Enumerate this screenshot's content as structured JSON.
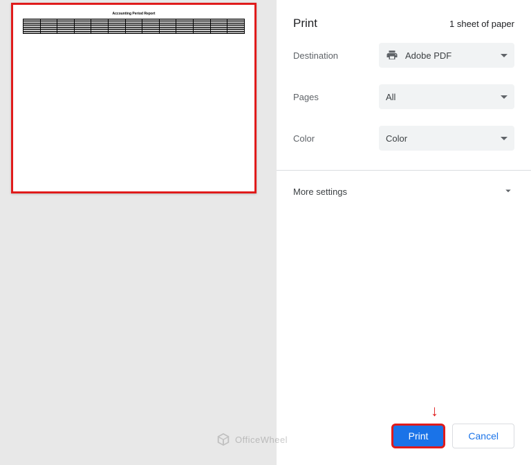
{
  "header": {
    "title": "Print",
    "sheet_info": "1 sheet of paper"
  },
  "settings": {
    "destination": {
      "label": "Destination",
      "value": "Adobe PDF"
    },
    "pages": {
      "label": "Pages",
      "value": "All"
    },
    "color": {
      "label": "Color",
      "value": "Color"
    }
  },
  "more_settings_label": "More settings",
  "buttons": {
    "print": "Print",
    "cancel": "Cancel"
  },
  "watermark": "OfficeWheel",
  "preview": {
    "title": "Accounting Period Report"
  }
}
